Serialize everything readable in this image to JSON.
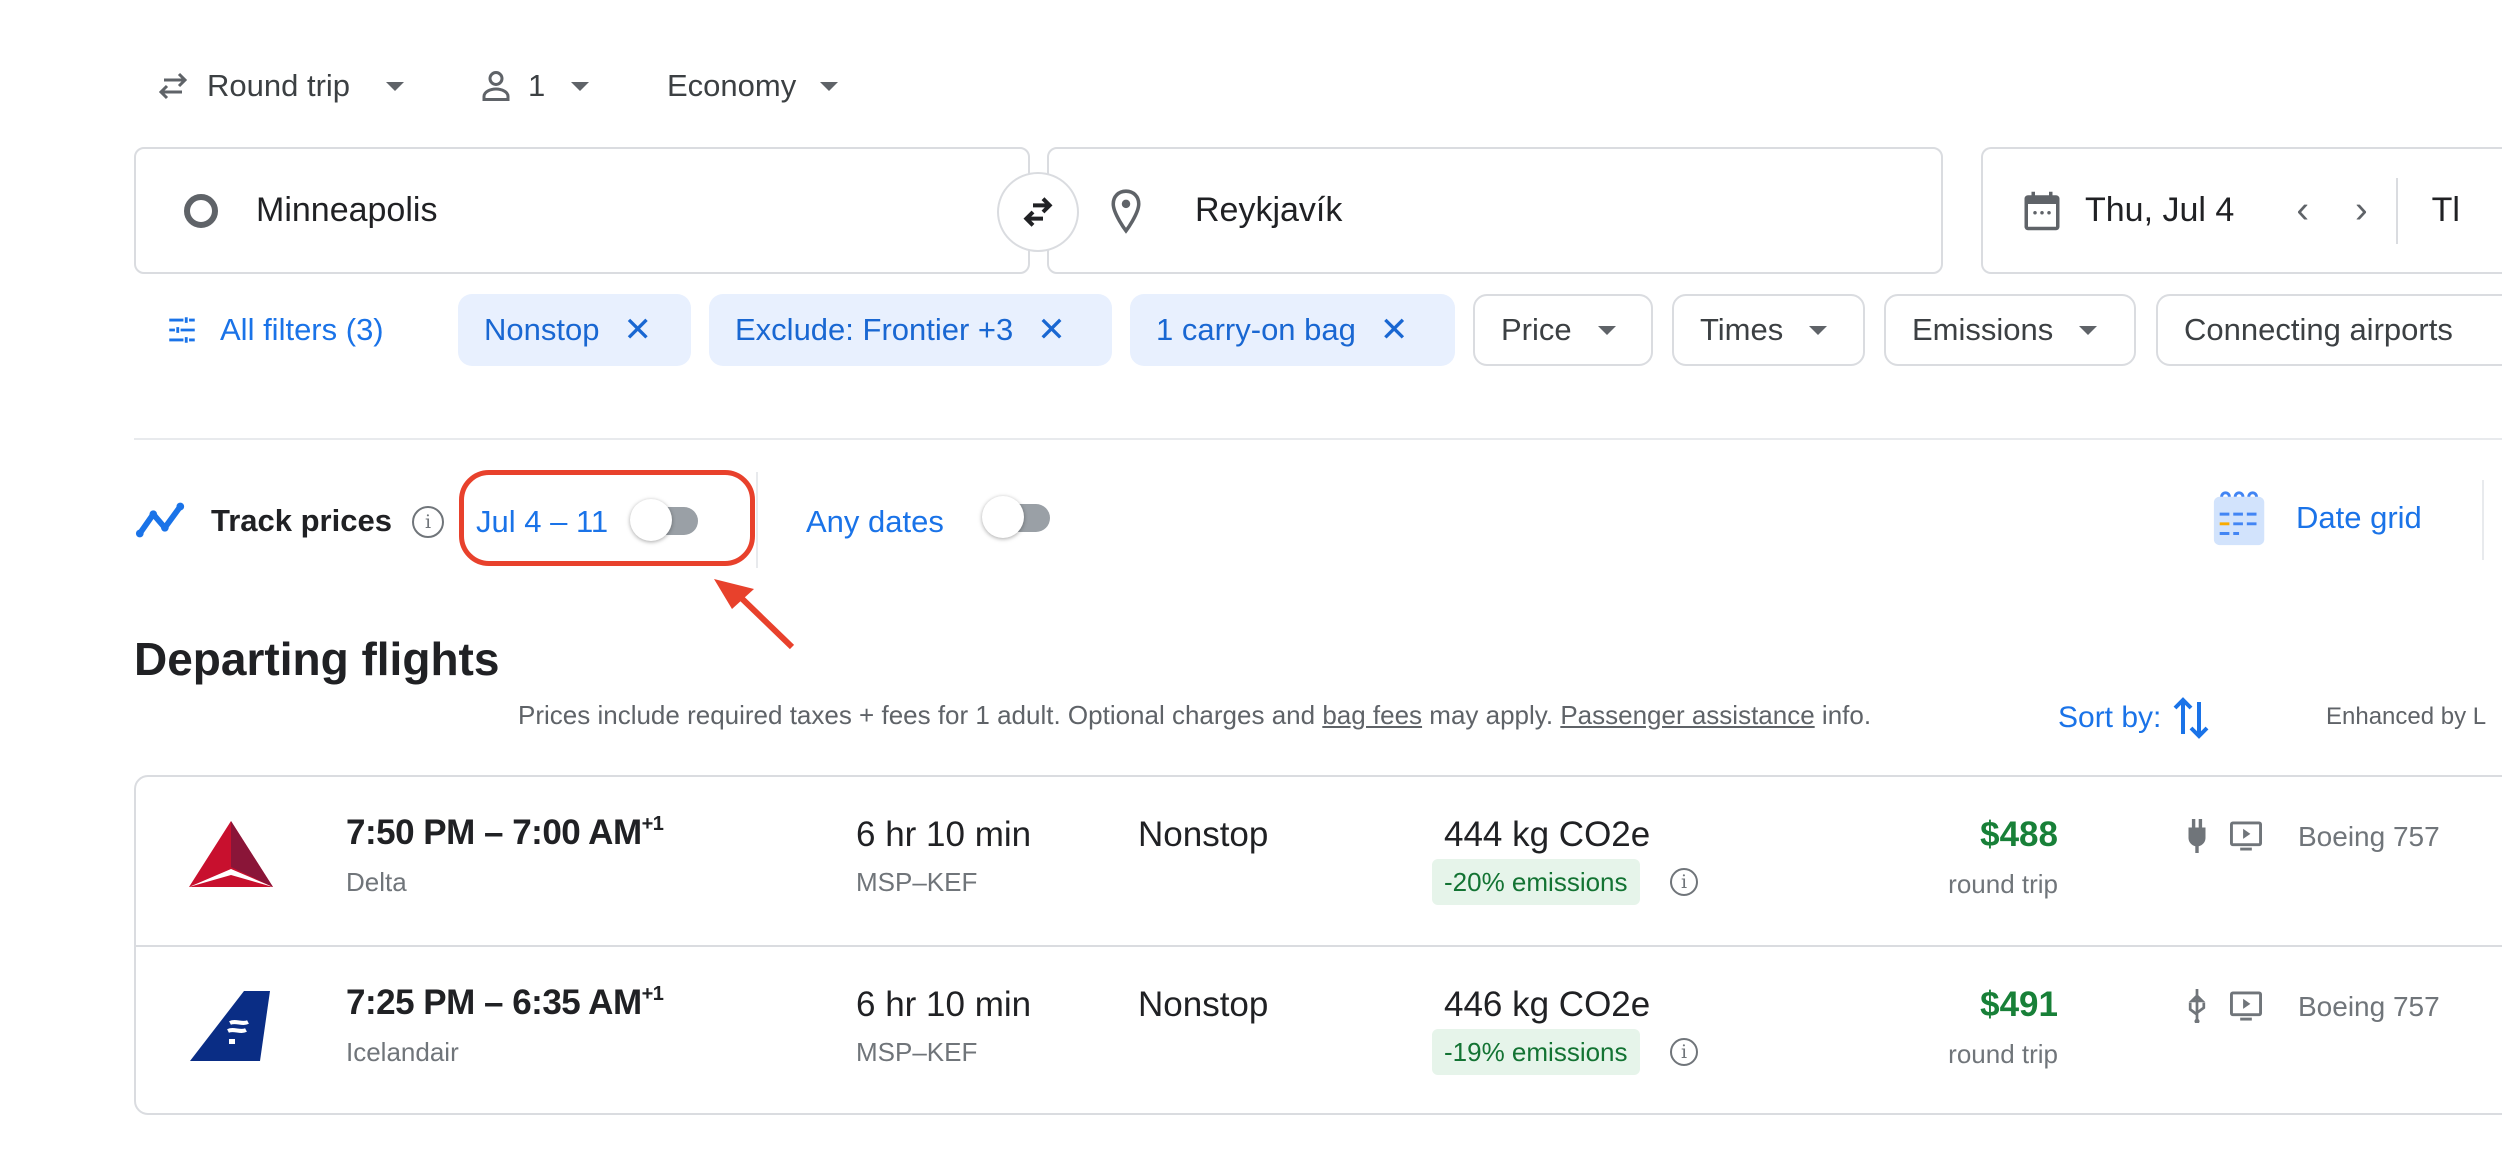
{
  "top_bar": {
    "trip_type": "Round trip",
    "passengers": "1",
    "cabin_class": "Economy"
  },
  "search": {
    "origin": "Minneapolis",
    "destination": "Reykjavík",
    "departure_date": "Thu, Jul 4",
    "return_date_partial": "Tl"
  },
  "filters": {
    "all_filters_label": "All filters (3)",
    "active_chips": [
      {
        "label": "Nonstop"
      },
      {
        "label": "Exclude: Frontier +3"
      },
      {
        "label": "1 carry-on bag"
      }
    ],
    "dropdown_chips": [
      {
        "label": "Price"
      },
      {
        "label": "Times"
      },
      {
        "label": "Emissions"
      },
      {
        "label": "Connecting airports"
      }
    ]
  },
  "track": {
    "label": "Track prices",
    "date_range_label": "Jul 4 – 11",
    "date_range_toggle_on": false,
    "any_dates_label": "Any dates",
    "any_dates_toggle_on": false,
    "date_grid_label": "Date grid"
  },
  "results": {
    "heading": "Departing flights",
    "disclaimer_prefix": "Prices include required taxes + fees for 1 adult. Optional charges and ",
    "bag_fees_link": "bag fees",
    "disclaimer_mid": " may apply. ",
    "passenger_assistance_link": "Passenger assistance",
    "disclaimer_suffix": " info.",
    "sort_label": "Sort by:",
    "enhanced_by_partial": "Enhanced by L",
    "flights": [
      {
        "airline": "Delta",
        "depart": "7:50 PM",
        "arrive": "7:00 AM",
        "day_offset": "+1",
        "duration": "6 hr 10 min",
        "route": "MSP–KEF",
        "stops": "Nonstop",
        "co2": "444 kg CO2e",
        "emissions_badge": "-20% emissions",
        "price": "$488",
        "price_type": "round trip",
        "amenities": [
          "power-outlet",
          "in-seat-video"
        ],
        "aircraft": "Boeing 757",
        "logo_color": "#c8102e"
      },
      {
        "airline": "Icelandair",
        "depart": "7:25 PM",
        "arrive": "6:35 AM",
        "day_offset": "+1",
        "duration": "6 hr 10 min",
        "route": "MSP–KEF",
        "stops": "Nonstop",
        "co2": "446 kg CO2e",
        "emissions_badge": "-19% emissions",
        "price": "$491",
        "price_type": "round trip",
        "amenities": [
          "usb-outlet",
          "in-seat-video"
        ],
        "aircraft": "Boeing 757",
        "logo_color": "#0a2d85"
      }
    ]
  },
  "colors": {
    "accent_blue": "#1a73e8",
    "chip_active_bg": "#e8f0fe",
    "price_green": "#188038",
    "emissions_bg": "#e6f4ea",
    "annotation_red": "#e8412c"
  }
}
